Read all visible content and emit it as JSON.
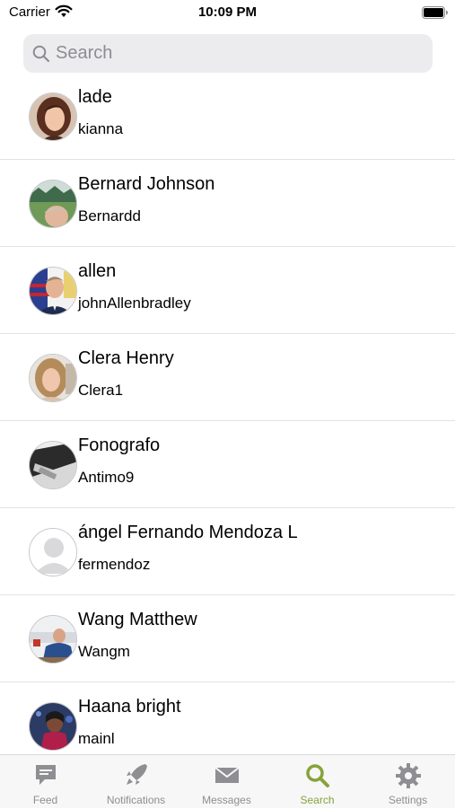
{
  "status_bar": {
    "carrier": "Carrier",
    "time": "10:09 PM"
  },
  "search": {
    "placeholder": "Search",
    "value": ""
  },
  "users": [
    {
      "name": "lade",
      "username": "kianna",
      "avatar": "woman-portrait"
    },
    {
      "name": "Bernard Johnson",
      "username": "Bernardd",
      "avatar": "man-outdoors"
    },
    {
      "name": "allen",
      "username": "johnAllenbradley",
      "avatar": "man-flag-uniform"
    },
    {
      "name": "Clera Henry",
      "username": "Clera1",
      "avatar": "woman-selfie"
    },
    {
      "name": "Fonografo",
      "username": "Antimo9",
      "avatar": "record-player"
    },
    {
      "name": "ángel Fernando Mendoza L",
      "username": "fermendoz",
      "avatar": "default-person"
    },
    {
      "name": "Wang Matthew",
      "username": "Wangm",
      "avatar": "man-indoor"
    },
    {
      "name": "Haana bright",
      "username": "mainl",
      "avatar": "woman-dark"
    }
  ],
  "tab_bar": {
    "tabs": [
      {
        "label": "Feed",
        "icon": "speech-bubble-icon",
        "active": false
      },
      {
        "label": "Notifications",
        "icon": "rocket-icon",
        "active": false
      },
      {
        "label": "Messages",
        "icon": "envelope-icon",
        "active": false
      },
      {
        "label": "Search",
        "icon": "magnifier-icon",
        "active": true
      },
      {
        "label": "Settings",
        "icon": "gear-icon",
        "active": false
      }
    ]
  },
  "colors": {
    "active_tab": "#86a33a",
    "inactive_tab": "#8e8e93",
    "search_bg": "#ececee"
  }
}
